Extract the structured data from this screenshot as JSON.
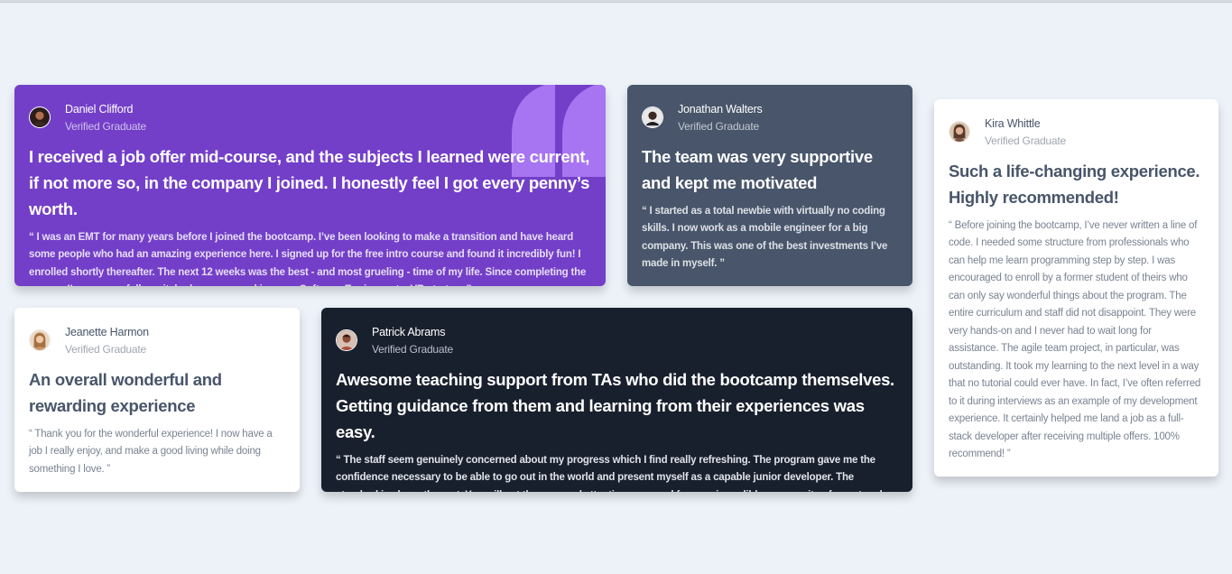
{
  "cards": [
    {
      "name": "Daniel Clifford",
      "role": "Verified Graduate",
      "title": "I received a job offer mid-course, and the subjects I learned were current, if not more so, in the company I joined. I honestly feel I got every penny’s worth.",
      "quote": "“ I was an EMT for many years before I joined the bootcamp. I’ve been looking to make a transition and have heard some people who had an amazing experience here. I signed up for the free intro course and found it incredibly fun! I enrolled shortly thereafter. The next 12 weeks was the best - and most grueling - time of my life. Since completing the course, I’ve successfully switched careers, working as a Software Engineer at a VR startup. ”"
    },
    {
      "name": "Jonathan Walters",
      "role": "Verified Graduate",
      "title": "The team was very supportive and kept me motivated",
      "quote": "“ I started as a total newbie with virtually no coding skills. I now work as a mobile engineer for a big company. This was one of the best investments I’ve made in myself. ”"
    },
    {
      "name": "Kira Whittle",
      "role": "Verified Graduate",
      "title": "Such a life-changing experience. Highly recommended!",
      "quote": "“ Before joining the bootcamp, I’ve never written a line of code. I needed some structure from professionals who can help me learn programming step by step. I was encouraged to enroll by a former student of theirs who can only say wonderful things about the program. The entire curriculum and staff did not disappoint. They were very hands-on and I never had to wait long for assistance. The agile team project, in particular, was outstanding. It took my learning to the next level in a way that no tutorial could ever have. In fact, I’ve often referred to it during interviews as an example of my development experience. It certainly helped me land a job as a full-stack developer after receiving multiple offers. 100% recommend! ”"
    },
    {
      "name": "Jeanette Harmon",
      "role": "Verified Graduate",
      "title": "An overall wonderful and rewarding experience",
      "quote": "“ Thank you for the wonderful experience! I now have a job I really enjoy, and make a good living while doing something I love. ”"
    },
    {
      "name": "Patrick Abrams",
      "role": "Verified Graduate",
      "title": "Awesome teaching support from TAs who did the bootcamp themselves. Getting guidance from them and learning from their experiences was easy.",
      "quote": "“ The staff seem genuinely concerned about my progress which I find really refreshing. The program gave me the confidence necessary to be able to go out in the world and present myself as a capable junior developer. The standard is above the rest. You will get the personal attention you need from an incredible community of smart and amazing people. ”"
    }
  ],
  "colors": {
    "page_bg": "#ecf2f8",
    "purple": "#733fc8",
    "grey_blue": "#48556a",
    "white": "#ffffff",
    "dark": "#19202d",
    "quote_mark": "#a775f1"
  },
  "icons": {
    "quote": "quote-icon"
  }
}
